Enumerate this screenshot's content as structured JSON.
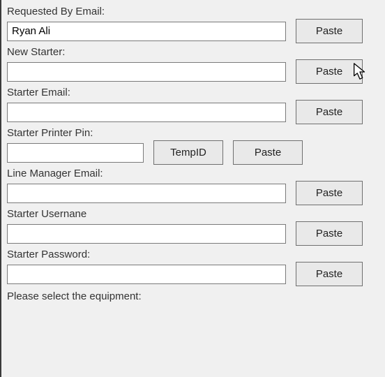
{
  "labels": {
    "requested_by_email": "Requested By Email:",
    "new_starter": "New Starter:",
    "starter_email": "Starter Email:",
    "starter_printer_pin": "Starter Printer Pin:",
    "line_manager_email": "Line Manager Email:",
    "starter_username": "Starter Usernane",
    "starter_password": "Starter Password:",
    "select_equipment": "Please select the equipment:"
  },
  "buttons": {
    "paste": "Paste",
    "temp_id": "TempID"
  },
  "fields": {
    "requested_by_email": "Ryan Ali",
    "new_starter": "",
    "starter_email": "",
    "starter_printer_pin": "",
    "line_manager_email": "",
    "starter_username": "",
    "starter_password": ""
  },
  "icons": {
    "cursor": "arrow-cursor"
  }
}
